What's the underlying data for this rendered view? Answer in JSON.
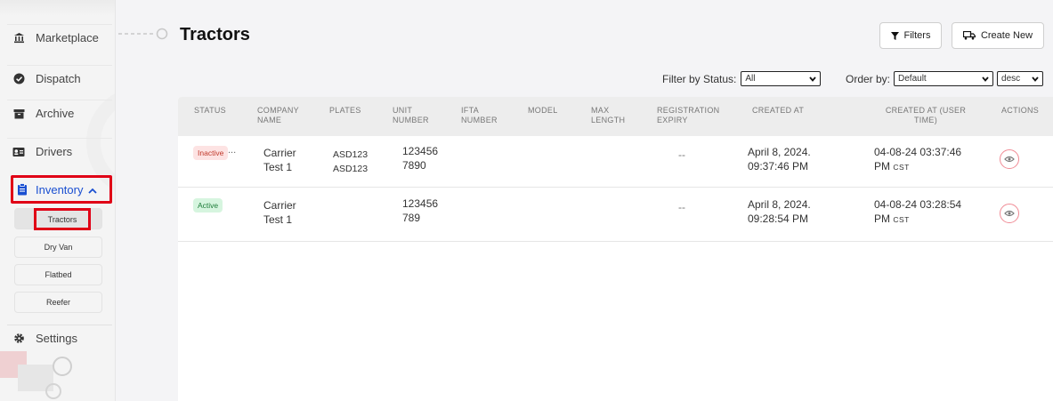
{
  "sidebar": {
    "items": [
      {
        "label": "Marketplace",
        "icon": "bank-icon"
      },
      {
        "label": "Dispatch",
        "icon": "circle-check-icon"
      },
      {
        "label": "Archive",
        "icon": "archive-icon"
      },
      {
        "label": "Drivers",
        "icon": "id-card-icon"
      },
      {
        "label": "Inventory",
        "icon": "clipboard-icon"
      },
      {
        "label": "Settings",
        "icon": "gear-icon"
      }
    ],
    "sub_items": [
      {
        "label": "Tractors"
      },
      {
        "label": "Dry Van"
      },
      {
        "label": "Flatbed"
      },
      {
        "label": "Reefer"
      }
    ]
  },
  "page": {
    "title": "Tractors"
  },
  "toolbar": {
    "filters_label": "Filters",
    "create_label": "Create New"
  },
  "filters": {
    "status_label": "Filter by Status:",
    "status_value": "All",
    "order_label": "Order by:",
    "order_value": "Default",
    "direction_value": "desc"
  },
  "table": {
    "headers": [
      "STATUS",
      "COMPANY NAME",
      "PLATES",
      "UNIT NUMBER",
      "IFTA NUMBER",
      "MODEL",
      "MAX LENGTH",
      "REGISTRATION EXPIRY",
      "CREATED AT",
      "CREATED AT (USER TIME)",
      "ACTIONS"
    ],
    "rows": [
      {
        "status": "Inactive",
        "status_overflow": "...",
        "company_line1": "Carrier",
        "company_line2": "Test 1",
        "plates_line1": "ASD123",
        "plates_line2": "ASD123",
        "unit_line1": "123456",
        "unit_line2": "7890",
        "registration_expiry": "--",
        "created_line1": "April 8, 2024.",
        "created_line2": "09:37:46 PM",
        "user_time_line1": "04-08-24 03:37:46",
        "user_time_line2": "PM",
        "user_time_tz": "CST"
      },
      {
        "status": "Active",
        "company_line1": "Carrier",
        "company_line2": "Test 1",
        "unit_line1": "123456",
        "unit_line2": "789",
        "registration_expiry": "--",
        "created_line1": "April 8, 2024.",
        "created_line2": "09:28:54 PM",
        "user_time_line1": "04-08-24 03:28:54",
        "user_time_line2": "PM",
        "user_time_tz": "CST"
      }
    ]
  },
  "colors": {
    "accent": "#1a4fd1",
    "highlight": "#e00016",
    "inactive": "#c0392b",
    "active": "#1e7d3a"
  }
}
